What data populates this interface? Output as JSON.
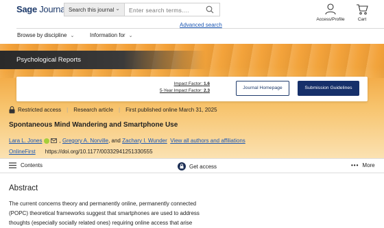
{
  "header": {
    "logo_bold": "Sage",
    "logo_light": "Journals",
    "search_scope": "Search this journal",
    "search_placeholder": "Enter search terms....",
    "advanced_search": "Advanced search",
    "access_label": "Access/Profile",
    "cart_label": "Cart"
  },
  "nav": {
    "browse": "Browse by discipline",
    "info": "Information for"
  },
  "journal": {
    "name": "Psychological Reports",
    "impact_label": "Impact Factor:",
    "impact_value": "1.6",
    "impact5_label": "5-Year Impact Factor:",
    "impact5_value": "2.3",
    "homepage_button": "Journal Homepage",
    "guidelines_button": "Submission Guidelines"
  },
  "article": {
    "access": "Restricted access",
    "type": "Research article",
    "published": "First published online March 31, 2025",
    "title": "Spontaneous Mind Wandering and Smartphone Use",
    "authors": [
      "Lara L. Jones",
      "Gregory A. Norville",
      "Zachary I. Wunder"
    ],
    "and_text": ", and",
    "view_all": "View all authors and affiliations",
    "onlinefirst": "OnlineFirst",
    "doi": "https://doi.org/10.1177/00332941251330555"
  },
  "toolbar": {
    "contents": "Contents",
    "get_access": "Get access",
    "more": "More"
  },
  "abstract": {
    "heading": "Abstract",
    "line1": "The current concerns theory and permanently online, permanently connected",
    "line2": "(POPC) theoretical frameworks suggest that smartphones are used to address",
    "line3": "thoughts (especially socially related ones) requiring online access that arise"
  },
  "colors": {
    "brand_navy": "#16306a",
    "link_blue": "#1a56b3",
    "banner_orange": "#f4a23a"
  }
}
